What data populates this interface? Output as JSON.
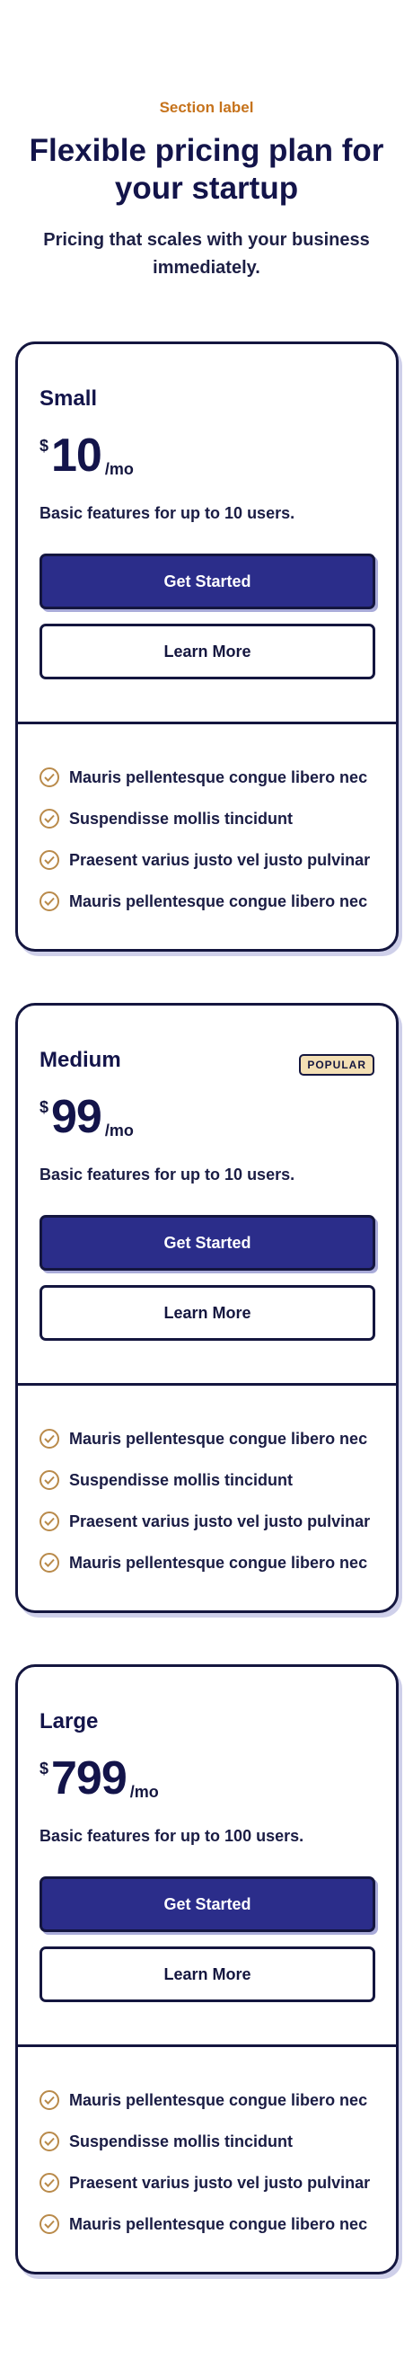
{
  "hero": {
    "section_label": "Section label",
    "title": "Flexible pricing plan for your startup",
    "subtitle": "Pricing that scales with your business immediately."
  },
  "colors": {
    "navy": "#14163f",
    "primary_button": "#2b2d8a",
    "accent_label": "#c6731c",
    "badge_bg": "#f3dfb4",
    "check": "#b98a4a"
  },
  "plans": [
    {
      "name": "Small",
      "currency": "$",
      "amount": "10",
      "per": "/mo",
      "description": "Basic features for up to 10 users.",
      "badge": "",
      "primary_label": "Get Started",
      "secondary_label": "Learn More",
      "features": [
        "Mauris pellentesque congue libero nec",
        "Suspendisse mollis tincidunt",
        "Praesent varius justo vel justo pulvinar",
        "Mauris pellentesque congue libero nec"
      ]
    },
    {
      "name": "Medium",
      "currency": "$",
      "amount": "99",
      "per": "/mo",
      "description": "Basic features for up to 10 users.",
      "badge": "POPULAR",
      "primary_label": "Get Started",
      "secondary_label": "Learn More",
      "features": [
        "Mauris pellentesque congue libero nec",
        "Suspendisse mollis tincidunt",
        "Praesent varius justo vel justo pulvinar",
        "Mauris pellentesque congue libero nec"
      ]
    },
    {
      "name": "Large",
      "currency": "$",
      "amount": "799",
      "per": "/mo",
      "description": "Basic features for up to 100 users.",
      "badge": "",
      "primary_label": "Get Started",
      "secondary_label": "Learn More",
      "features": [
        "Mauris pellentesque congue libero nec",
        "Suspendisse mollis tincidunt",
        "Praesent varius justo vel justo pulvinar",
        "Mauris pellentesque congue libero nec"
      ]
    }
  ]
}
